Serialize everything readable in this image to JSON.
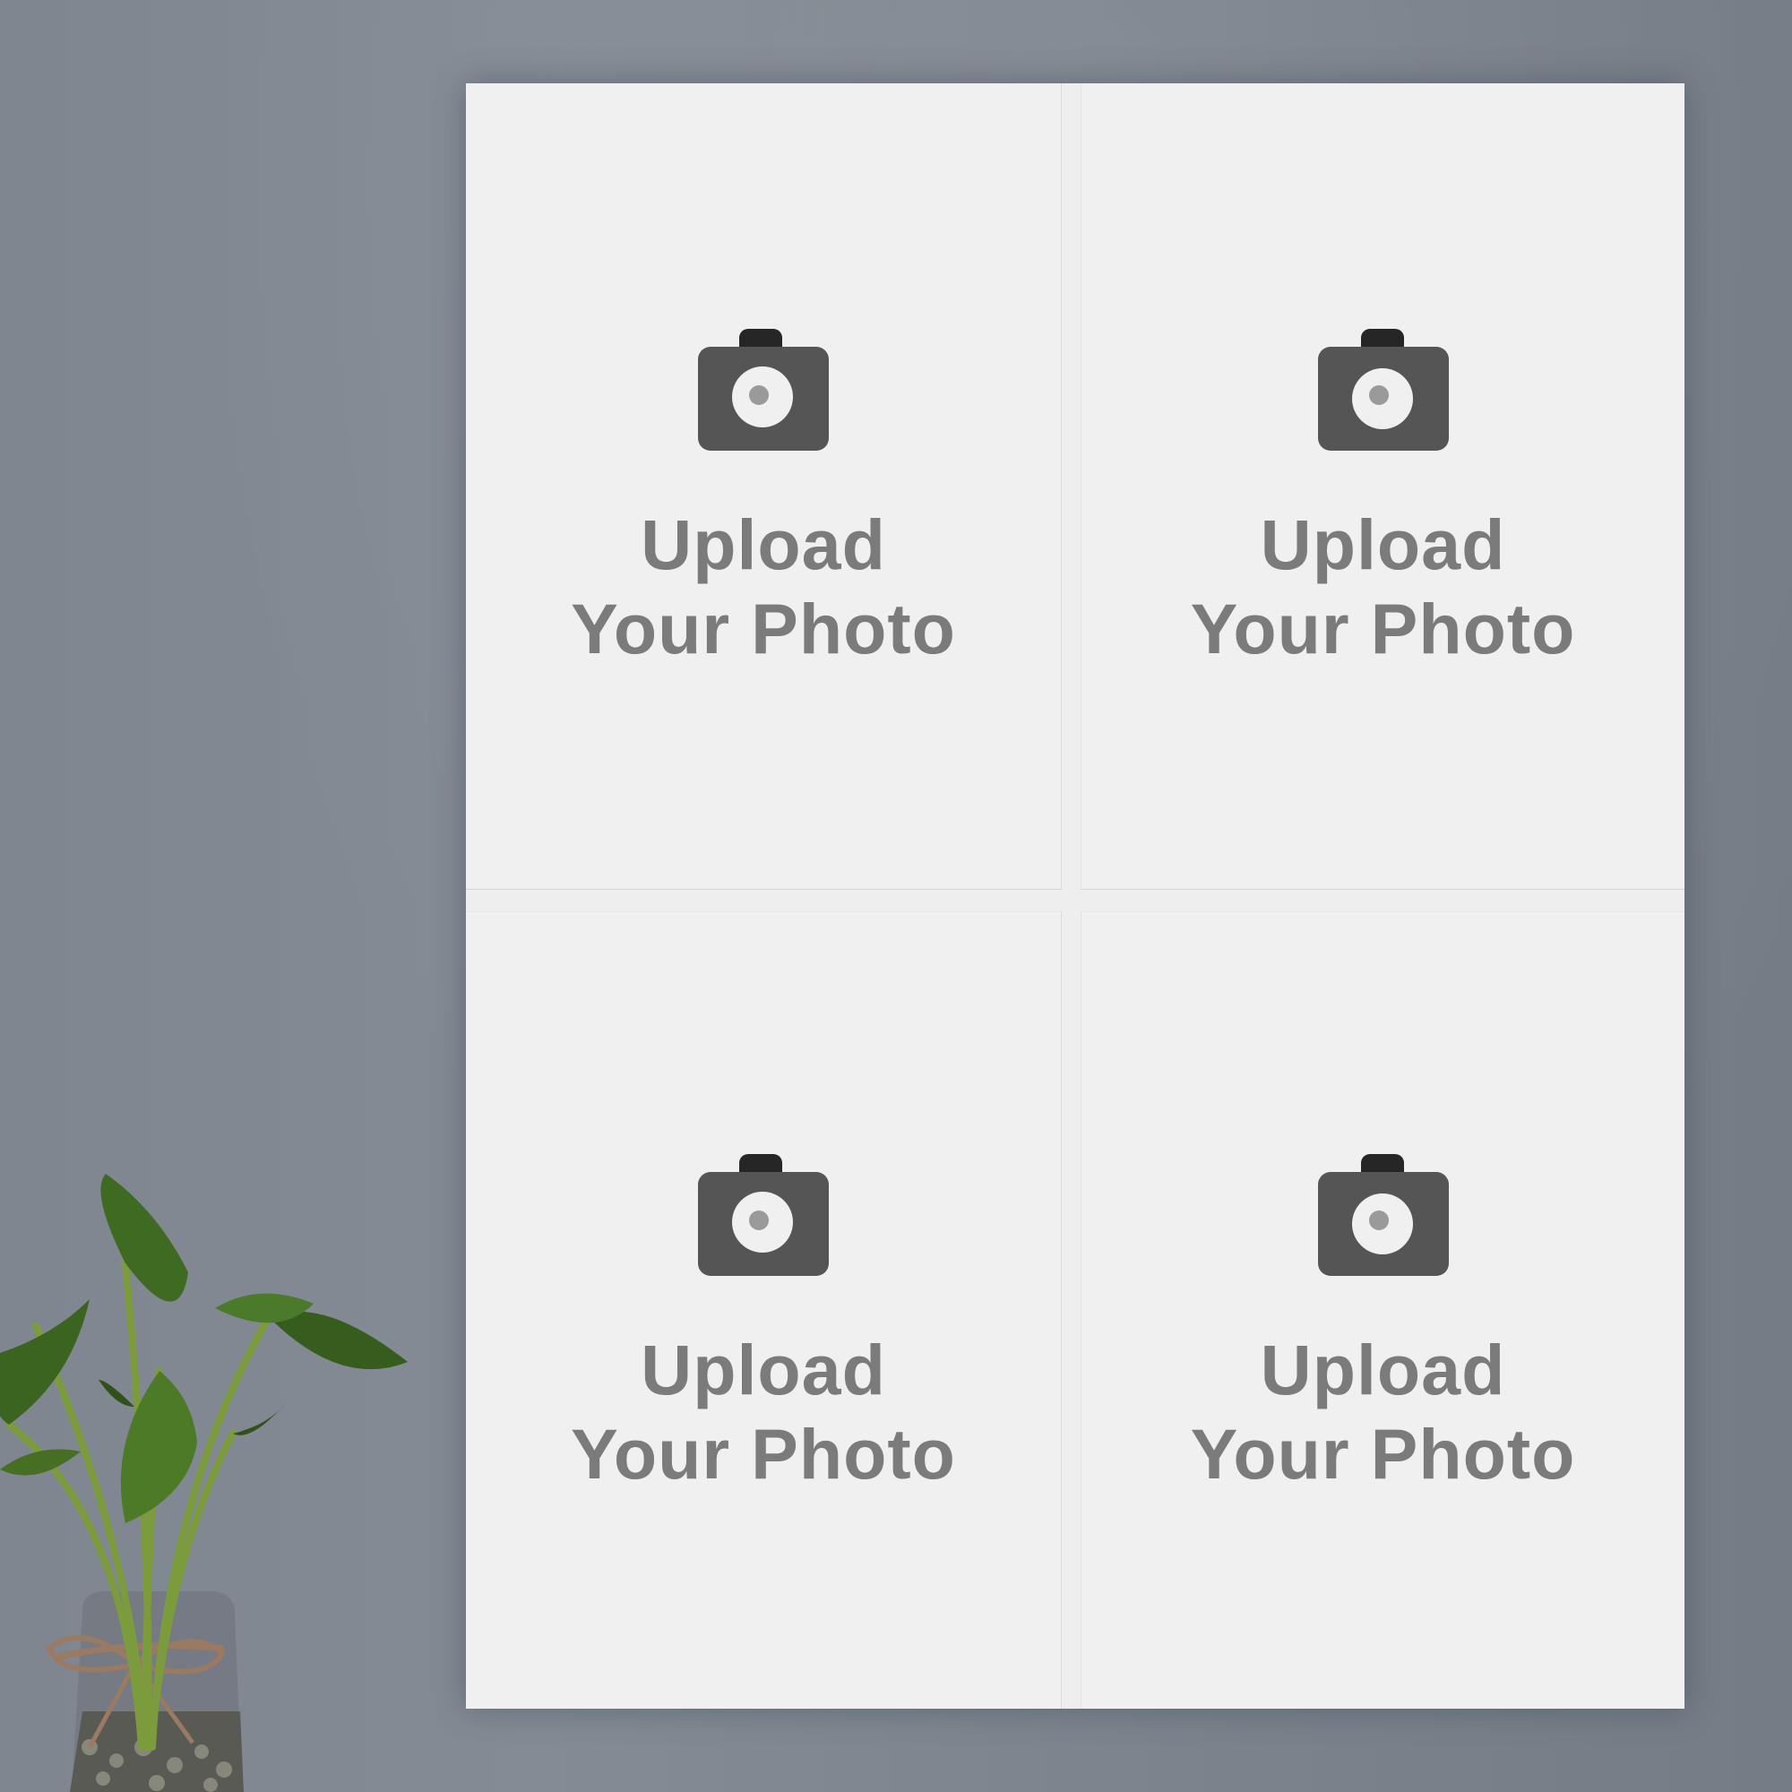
{
  "slots": [
    {
      "line1": "Upload",
      "line2": "Your Photo"
    },
    {
      "line1": "Upload",
      "line2": "Your Photo"
    },
    {
      "line1": "Upload",
      "line2": "Your Photo"
    },
    {
      "line1": "Upload",
      "line2": "Your Photo"
    }
  ],
  "icons": {
    "slot_icon": "camera-icon",
    "decoration": "potted-plant"
  },
  "colors": {
    "wall": "#80878f",
    "poster": "#eeeeee",
    "slot": "#f0f0f0",
    "text": "#7b7b7b",
    "camera_body": "#555555",
    "camera_top": "#262626"
  }
}
